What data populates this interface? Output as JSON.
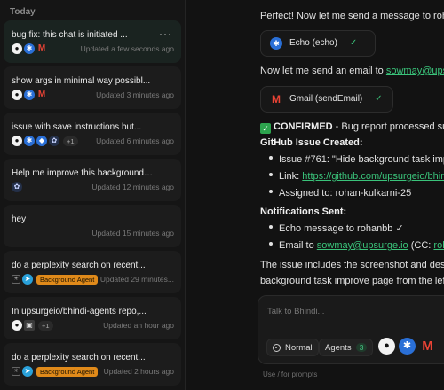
{
  "sidebar": {
    "section_label": "Today",
    "more_label": "···",
    "chats": [
      {
        "title": "bug fix: this chat is initiated ...",
        "updated": "Updated a few seconds ago",
        "icons": [
          "github-icon",
          "echo-icon",
          "gmail-icon"
        ],
        "active": true
      },
      {
        "title": "show args in minimal way possibl...",
        "updated": "Updated 3 minutes ago",
        "icons": [
          "github-icon",
          "echo-icon",
          "gmail-icon"
        ]
      },
      {
        "title": "issue with save instructions but...",
        "updated": "Updated 6 minutes ago",
        "icons": [
          "github-icon",
          "echo-icon",
          "linear-icon",
          "bhindi-icon"
        ],
        "extra": "+1"
      },
      {
        "title": "Help me improve this background ...",
        "updated": "Updated 12 minutes ago",
        "icons": [
          "bhindi-icon"
        ]
      },
      {
        "title": "hey",
        "updated": "Updated 15 minutes ago",
        "icons": []
      },
      {
        "title": "do a perplexity search on recent...",
        "updated": "Updated 29 minutes...",
        "icons": [
          "perplexity-icon",
          "telegram-icon"
        ],
        "tag": "Background Agent"
      },
      {
        "title": "In upsurgeio/bhindi-agents repo,...",
        "updated": "Updated an hour ago",
        "icons": [
          "github-icon",
          "square-icon"
        ],
        "extra": "+1"
      },
      {
        "title": "do a perplexity search on recent...",
        "updated": "Updated 2 hours ago",
        "icons": [
          "perplexity-icon",
          "telegram-icon"
        ],
        "tag": "Background Agent"
      }
    ]
  },
  "main": {
    "msg1": "Perfect! Now let me send a message to rohan",
    "tool1": {
      "name": "Echo (echo)",
      "check": "✓"
    },
    "msg2_prefix": "Now let me send an email to ",
    "msg2_link": "sowmay@upsurge.io",
    "tool2": {
      "name": "Gmail (sendEmail)",
      "check": "✓"
    },
    "confirmed_label": "CONFIRMED",
    "confirmed_rest": " - Bug report processed successfully",
    "issue_heading": "GitHub Issue Created:",
    "issue_bullets": {
      "issue": "Issue #761: \"Hide background task improve page\"",
      "link_prefix": "Link: ",
      "link": "https://github.com/upsurgeio/bhindi-agents",
      "assigned": "Assigned to: rohan-kulkarni-25"
    },
    "notif_heading": "Notifications Sent:",
    "notif_bullets": {
      "echo": "Echo message to rohanbb ✓",
      "email_prefix": "Email to ",
      "email_link": "sowmay@upsurge.io",
      "email_suffix": " (CC: ",
      "email_cc": "rohan"
    },
    "summary_line1": "The issue includes the screenshot and description",
    "summary_line2": "background task improve page from the left"
  },
  "composer": {
    "placeholder": "Talk to Bhindi...",
    "mode_label": "Normal",
    "agents_label": "Agents",
    "agents_count": "3",
    "hint": "Use / for prompts"
  }
}
